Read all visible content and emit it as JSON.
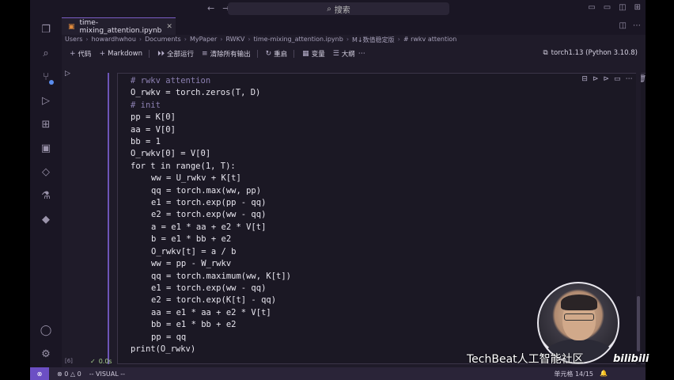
{
  "window": {
    "search_label": "搜索"
  },
  "tab": {
    "filename": "time-mixing_attention.ipynb"
  },
  "breadcrumb": [
    "Users",
    "howardhwhou",
    "Documents",
    "MyPaper",
    "RWKV",
    "time-mixing_attention.ipynb",
    "M↓数值稳定版",
    "# rwkv attention"
  ],
  "toolbar": {
    "add_code": "代码",
    "add_markdown": "Markdown",
    "run_all": "全部运行",
    "clear_outputs": "清除所有输出",
    "restart": "重启",
    "variables": "变量",
    "outline": "大纲",
    "kernel": "torch1.13 (Python 3.10.8)"
  },
  "code_lines": [
    {
      "text": "# rwkv attention",
      "comment": true,
      "indent": 0
    },
    {
      "text": "O_rwkv = torch.zeros(T, D)",
      "indent": 0
    },
    {
      "text": "# init",
      "comment": true,
      "indent": 0
    },
    {
      "text": "pp = K[0]",
      "indent": 0
    },
    {
      "text": "aa = V[0]",
      "indent": 0
    },
    {
      "text": "bb = 1",
      "indent": 0
    },
    {
      "text": "O_rwkv[0] = V[0]",
      "indent": 0
    },
    {
      "text": "for t in range(1, T):",
      "indent": 0
    },
    {
      "text": "ww = U_rwkv + K[t]",
      "indent": 1
    },
    {
      "text": "qq = torch.max(ww, pp)",
      "indent": 1
    },
    {
      "text": "e1 = torch.exp(pp - qq)",
      "indent": 1
    },
    {
      "text": "e2 = torch.exp(ww - qq)",
      "indent": 1
    },
    {
      "text": "a = e1 * aa + e2 * V[t]",
      "indent": 1
    },
    {
      "text": "b = e1 * bb + e2",
      "indent": 1
    },
    {
      "text": "O_rwkv[t] = a / b",
      "indent": 1
    },
    {
      "text": "ww = pp - W_rwkv",
      "indent": 1
    },
    {
      "text": "qq = torch.maximum(ww, K[t])",
      "indent": 1
    },
    {
      "text": "e1 = torch.exp(ww - qq)",
      "indent": 1
    },
    {
      "text": "e2 = torch.exp(K[t] - qq)",
      "indent": 1
    },
    {
      "text": "aa = e1 * aa + e2 * V[t]",
      "indent": 1
    },
    {
      "text": "bb = e1 * bb + e2",
      "indent": 1
    },
    {
      "text": "pp = qq",
      "indent": 1
    },
    {
      "text": "print(O_rwkv)",
      "indent": 0
    }
  ],
  "cell": {
    "exec_count": "[6]",
    "exec_time": "0.0s"
  },
  "statusbar": {
    "remote": "⊗",
    "errors": "0",
    "warnings": "0",
    "mode": "-- VISUAL --",
    "cell_position": "单元格 14/15"
  },
  "overlay": {
    "watermark": "TechBeat人工智能社区",
    "bili": "bilibili"
  },
  "colors": {
    "accent": "#6c4fc4",
    "background": "#1f1b29"
  }
}
